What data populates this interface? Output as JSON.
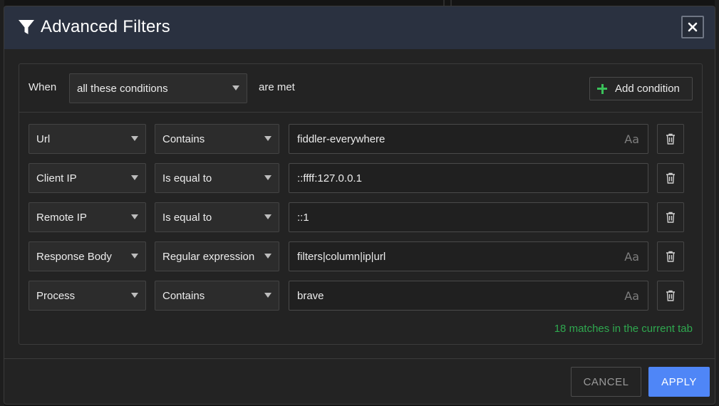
{
  "dialog": {
    "title": "Advanced Filters",
    "title_icon": "filter-icon",
    "close_icon": "close-icon"
  },
  "header": {
    "when_label": "When",
    "logic_select": {
      "value": "all these conditions"
    },
    "met_label": "are met",
    "add_condition_label": "Add condition",
    "add_icon": "plus-icon"
  },
  "conditions": [
    {
      "field": "Url",
      "operator": "Contains",
      "value": "fiddler-everywhere",
      "case_toggle": "Aa"
    },
    {
      "field": "Client IP",
      "operator": "Is equal to",
      "value": "::ffff:127.0.0.1",
      "case_toggle": ""
    },
    {
      "field": "Remote IP",
      "operator": "Is equal to",
      "value": "::1",
      "case_toggle": ""
    },
    {
      "field": "Response Body",
      "operator": "Regular expression",
      "value": "filters|column|ip|url",
      "case_toggle": "Aa"
    },
    {
      "field": "Process",
      "operator": "Contains",
      "value": "brave",
      "case_toggle": "Aa"
    }
  ],
  "status": {
    "matches_text": "18 matches in the current tab"
  },
  "footer": {
    "cancel_label": "CANCEL",
    "apply_label": "APPLY"
  },
  "colors": {
    "accent": "#4f86f7",
    "success": "#2fa84f",
    "titlebar": "#2a3140"
  }
}
